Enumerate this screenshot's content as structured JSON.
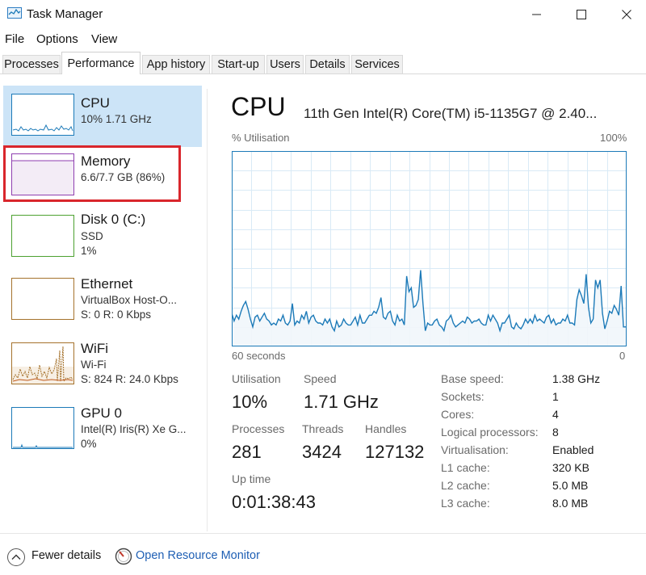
{
  "window": {
    "title": "Task Manager"
  },
  "menu": {
    "items": [
      "File",
      "Options",
      "View"
    ]
  },
  "tabs": [
    "Processes",
    "Performance",
    "App history",
    "Start-up",
    "Users",
    "Details",
    "Services"
  ],
  "active_tab": "Performance",
  "sidebar": {
    "items": [
      {
        "name": "CPU",
        "sub1": "10% 1.71 GHz",
        "sub2": "",
        "color": "#1c7ab8"
      },
      {
        "name": "Memory",
        "sub1": "6.6/7.7 GB (86%)",
        "sub2": "",
        "color": "#8f3fb0"
      },
      {
        "name": "Disk 0 (C:)",
        "sub1": "SSD",
        "sub2": "1%",
        "color": "#4ca130"
      },
      {
        "name": "Ethernet",
        "sub1": "VirtualBox Host-O...",
        "sub2": "S: 0 R: 0 Kbps",
        "color": "#a5722c"
      },
      {
        "name": "WiFi",
        "sub1": "Wi-Fi",
        "sub2": "S: 824 R: 24.0 Kbps",
        "color": "#a5722c"
      },
      {
        "name": "GPU 0",
        "sub1": "Intel(R) Iris(R) Xe G...",
        "sub2": "0%",
        "color": "#1c7ab8"
      }
    ],
    "selected": "CPU",
    "highlighted": "Memory"
  },
  "main": {
    "title": "CPU",
    "model": "11th Gen Intel(R) Core(TM) i5-1135G7 @ 2.40...",
    "graph": {
      "y_label": "% Utilisation",
      "y_max_label": "100%",
      "x_left_label": "60 seconds",
      "x_right_label": "0",
      "series": [
        17,
        13,
        16,
        14,
        18,
        21,
        23,
        19,
        14,
        10,
        15,
        16,
        13,
        15,
        17,
        14,
        13,
        11,
        12,
        11,
        14,
        13,
        16,
        12,
        11,
        13,
        22,
        11,
        13,
        12,
        16,
        14,
        18,
        12,
        15,
        16,
        13,
        12,
        12,
        11,
        14,
        12,
        14,
        10,
        8,
        13,
        10,
        11,
        14,
        12,
        11,
        11,
        13,
        15,
        11,
        16,
        12,
        12,
        14,
        16,
        16,
        18,
        17,
        20,
        25,
        15,
        14,
        17,
        18,
        13,
        11,
        16,
        13,
        14,
        11,
        36,
        28,
        30,
        20,
        21,
        24,
        39,
        22,
        8,
        12,
        11,
        11,
        13,
        14,
        11,
        10,
        8,
        13,
        14,
        16,
        12,
        10,
        11,
        12,
        13,
        12,
        15,
        14,
        12,
        13,
        13,
        14,
        12,
        11,
        11,
        16,
        13,
        16,
        14,
        12,
        8,
        12,
        12,
        14,
        16,
        10,
        9,
        12,
        10,
        9,
        11,
        14,
        12,
        14,
        12,
        16,
        13,
        14,
        13,
        12,
        15,
        16,
        12,
        14,
        11,
        12,
        12,
        14,
        13,
        16,
        12,
        12,
        11,
        24,
        29,
        26,
        22,
        37,
        20,
        12,
        14,
        34,
        30,
        34,
        17,
        9,
        13,
        18,
        17,
        21,
        19,
        16,
        31,
        10,
        10
      ]
    },
    "stats": {
      "utilisation_label": "Utilisation",
      "utilisation": "10%",
      "speed_label": "Speed",
      "speed": "1.71 GHz",
      "processes_label": "Processes",
      "processes": "281",
      "threads_label": "Threads",
      "threads": "3424",
      "handles_label": "Handles",
      "handles": "127132",
      "uptime_label": "Up time",
      "uptime": "0:01:38:43"
    },
    "details": [
      {
        "label": "Base speed:",
        "value": "1.38 GHz"
      },
      {
        "label": "Sockets:",
        "value": "1"
      },
      {
        "label": "Cores:",
        "value": "4"
      },
      {
        "label": "Logical processors:",
        "value": "8"
      },
      {
        "label": "Virtualisation:",
        "value": "Enabled"
      },
      {
        "label": "L1 cache:",
        "value": "320 KB"
      },
      {
        "label": "L2 cache:",
        "value": "5.0 MB"
      },
      {
        "label": "L3 cache:",
        "value": "8.0 MB"
      }
    ]
  },
  "footer": {
    "fewer_details": "Fewer details",
    "open_resource_monitor": "Open Resource Monitor"
  },
  "colors": {
    "cpu_line": "#1c7ab8",
    "cpu_fill": "#f1f6fb",
    "grid": "#d9eaf6",
    "selected_bg": "#cce4f7",
    "highlight": "#d9262c",
    "link": "#1e5fb4"
  }
}
